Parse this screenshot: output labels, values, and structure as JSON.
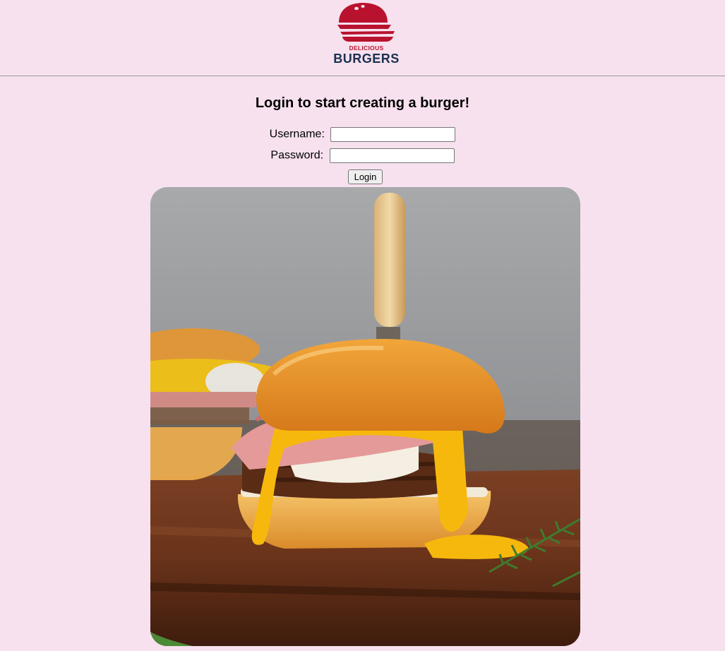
{
  "brand": {
    "logo_small_text": "DELICIOUS",
    "logo_big_text": "BURGERS",
    "accent_color": "#b8122e",
    "text_color": "#1c2f52"
  },
  "page": {
    "background": "#f7e1ee",
    "title": "Login to start creating a burger!"
  },
  "form": {
    "username_label": "Username:",
    "username_value": "",
    "password_label": "Password:",
    "password_value": "",
    "login_label": "Login"
  },
  "hero": {
    "alt": "burger-photo"
  }
}
